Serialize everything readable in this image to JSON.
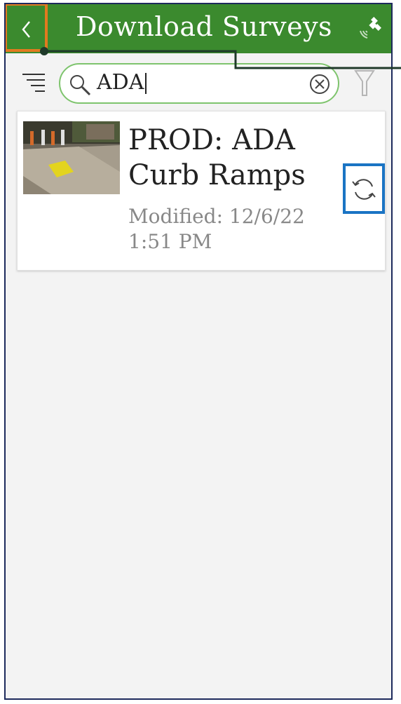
{
  "header": {
    "title": "Download Surveys",
    "back_icon": "chevron-left-icon",
    "status_icon": "satellite-signal-icon"
  },
  "toolbar": {
    "sort_icon": "sort-list-icon",
    "search": {
      "value": "ADA",
      "search_icon": "magnifier-icon",
      "clear_icon": "clear-circle-x-icon"
    },
    "filter_icon": "filter-funnel-icon"
  },
  "surveys": [
    {
      "title": "PROD: ADA Curb Ramps",
      "modified": "Modified: 12/6/22 1:51 PM",
      "action_icon": "sync-refresh-icon"
    }
  ],
  "colors": {
    "header_bg": "#3b8a2e",
    "back_highlight": "#e27a1f",
    "sync_highlight": "#1a74c4",
    "search_border": "#7ec46d",
    "frame_border": "#1d2a5c"
  }
}
